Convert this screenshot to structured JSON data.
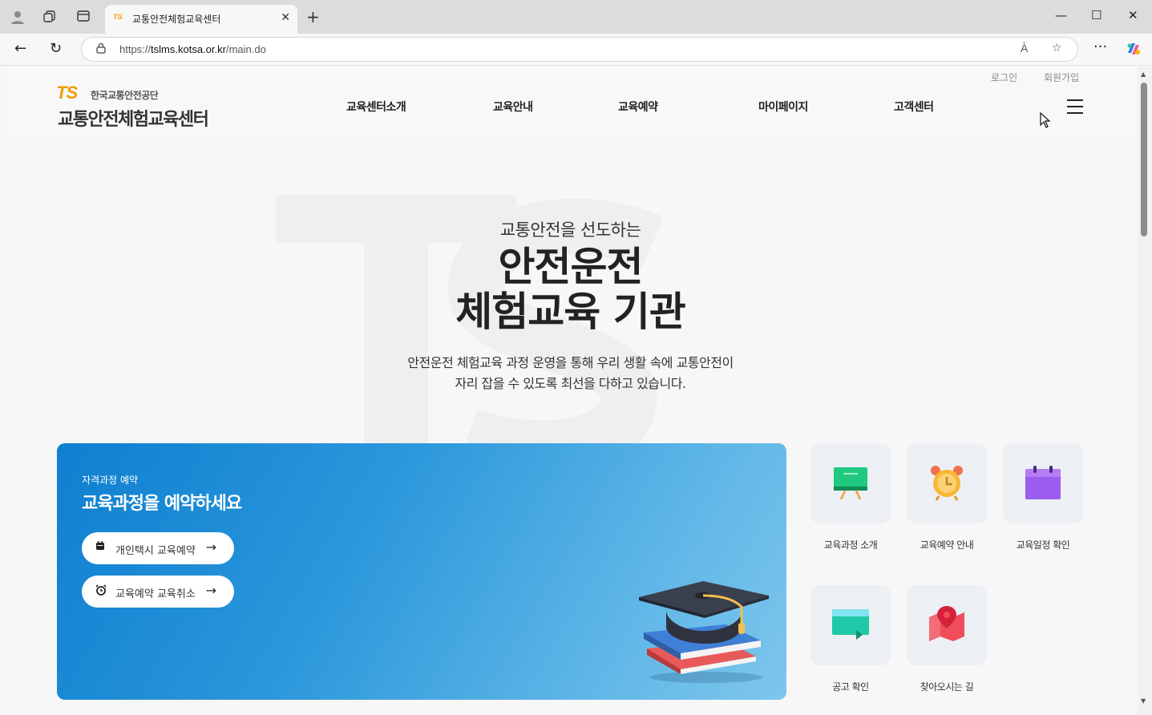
{
  "browser": {
    "tab_favicon_text": "TS",
    "tab_title": "교통안전체험교육센터",
    "url_scheme": "https://",
    "url_host": "tslms.kotsa.or.kr",
    "url_path": "/main.do"
  },
  "header": {
    "logo_ts": "TS",
    "logo_corp": "한국교통안전공단",
    "logo_name": "교통안전체험교육센터",
    "nav": [
      "교육센터소개",
      "교육안내",
      "교육예약",
      "마이페이지",
      "고객센터"
    ],
    "util": {
      "login": "로그인",
      "signup": "회원가입"
    }
  },
  "hero": {
    "bg_text": "TS",
    "subtitle": "교통안전을 선도하는",
    "title_line1": "안전운전",
    "title_line2": "체험교육 기관",
    "desc_line1": "안전운전 체험교육 과정 운영을 통해 우리 생활 속에 교통안전이",
    "desc_line2": "자리 잡을 수 있도록 최선을 다하고 있습니다."
  },
  "banner": {
    "kicker": "자격과정 예약",
    "title": "교육과정을 예약하세요",
    "buttons": [
      {
        "label": "개인택시 교육예약",
        "icon": "calendar-icon"
      },
      {
        "label": "교육예약 교육취소",
        "icon": "alarm-icon"
      }
    ]
  },
  "quick_menu": [
    {
      "label": "교육과정 소개",
      "icon": "whiteboard-icon",
      "color": "#1fc97f"
    },
    {
      "label": "교육예약 안내",
      "icon": "alarm-clock-icon",
      "color": "#f7b733"
    },
    {
      "label": "교육일정 확인",
      "icon": "calendar-icon",
      "color": "#9b5cf0"
    },
    {
      "label": "공고 확인",
      "icon": "monitor-icon",
      "color": "#1fc9a8"
    },
    {
      "label": "찾아오시는 길",
      "icon": "map-pin-icon",
      "color": "#f04d5a"
    }
  ],
  "colors": {
    "brand_blue": "#1c5fb3",
    "brand_orange": "#f29b00",
    "banner_start": "#0f7fd0",
    "banner_end": "#7dc6ec"
  }
}
